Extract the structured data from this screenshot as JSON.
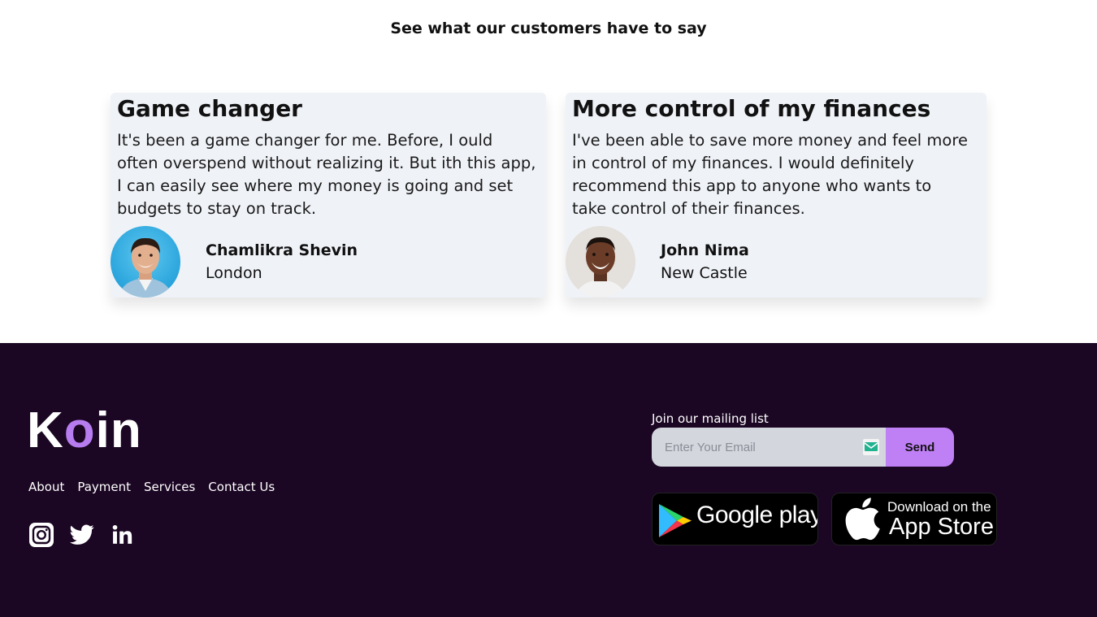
{
  "testimonials": {
    "title": "See what our customers have to say",
    "cards": [
      {
        "heading": "Game changer",
        "body": "It's been a game changer for me. Before, I ould often overspend without realizing it. But ith this app, I can easily see where my money is going and set budgets to stay on track.",
        "name": "Chamlikra Shevin",
        "city": "London"
      },
      {
        "heading": "More control of my finances",
        "body": "I've been able to save more money and feel more in control of my finances. I would definitely recommend this app to anyone who wants to take control of their finances.",
        "name": "John Nima",
        "city": "New Castle"
      }
    ]
  },
  "footer": {
    "logo": {
      "part1": "K",
      "part2": "o",
      "part3": "in"
    },
    "nav": [
      "About",
      "Payment",
      "Services",
      "Contact Us"
    ],
    "socials": [
      "instagram-icon",
      "twitter-icon",
      "linkedin-icon"
    ],
    "mailing": {
      "label": "Join our mailing list",
      "placeholder": "Enter Your Email",
      "send_label": "Send"
    },
    "badges": {
      "google": "Google play",
      "apple_small": "Download on the",
      "apple_big": "App Store"
    }
  },
  "colors": {
    "footer_bg": "#1b0623",
    "accent": "#b67cf0",
    "send_button": "#c080f5",
    "card_bg": "#eff2f7"
  }
}
